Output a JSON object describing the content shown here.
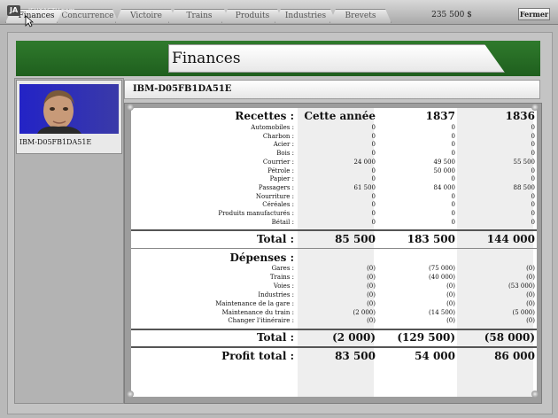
{
  "top_bar": {
    "logo": "JA",
    "logo_sub": "JEUXACTU.com",
    "tabs": [
      {
        "label": "Finances",
        "active": true
      },
      {
        "label": "Concurrence",
        "active": false
      },
      {
        "label": "Victoire",
        "active": false
      },
      {
        "label": "Trains",
        "active": false
      },
      {
        "label": "Produits",
        "active": false
      },
      {
        "label": "Industries",
        "active": false
      },
      {
        "label": "Brevets",
        "active": false
      }
    ],
    "money": "235 500 $",
    "close_label": "Fermer"
  },
  "page_title": "Finances",
  "company": {
    "name": "IBM-D05FB1DA51E"
  },
  "columns": [
    "Cette année",
    "1837",
    "1836"
  ],
  "revenue": {
    "heading": "Recettes :",
    "rows": [
      {
        "label": "Automobiles :",
        "values": [
          "0",
          "0",
          "0"
        ]
      },
      {
        "label": "Charbon :",
        "values": [
          "0",
          "0",
          "0"
        ]
      },
      {
        "label": "Acier :",
        "values": [
          "0",
          "0",
          "0"
        ]
      },
      {
        "label": "Bois :",
        "values": [
          "0",
          "0",
          "0"
        ]
      },
      {
        "label": "Courrier :",
        "values": [
          "24 000",
          "49 500",
          "55 500"
        ]
      },
      {
        "label": "Pétrole :",
        "values": [
          "0",
          "50 000",
          "0"
        ]
      },
      {
        "label": "Papier :",
        "values": [
          "0",
          "0",
          "0"
        ]
      },
      {
        "label": "Passagers :",
        "values": [
          "61 500",
          "84 000",
          "88 500"
        ]
      },
      {
        "label": "Nourriture :",
        "values": [
          "0",
          "0",
          "0"
        ]
      },
      {
        "label": "Céréales :",
        "values": [
          "0",
          "0",
          "0"
        ]
      },
      {
        "label": "Produits manufacturés :",
        "values": [
          "0",
          "0",
          "0"
        ]
      },
      {
        "label": "Bétail :",
        "values": [
          "0",
          "0",
          "0"
        ]
      }
    ],
    "total_label": "Total :",
    "totals": [
      "85 500",
      "183 500",
      "144 000"
    ]
  },
  "expenses": {
    "heading": "Dépenses :",
    "rows": [
      {
        "label": "Gares :",
        "values": [
          "(0)",
          "(75 000)",
          "(0)"
        ]
      },
      {
        "label": "Trains :",
        "values": [
          "(0)",
          "(40 000)",
          "(0)"
        ]
      },
      {
        "label": "Voies :",
        "values": [
          "(0)",
          "(0)",
          "(53 000)"
        ]
      },
      {
        "label": "Industries :",
        "values": [
          "(0)",
          "(0)",
          "(0)"
        ]
      },
      {
        "label": "Maintenance de la gare :",
        "values": [
          "(0)",
          "(0)",
          "(0)"
        ]
      },
      {
        "label": "Maintenance du train :",
        "values": [
          "(2 000)",
          "(14 500)",
          "(5 000)"
        ]
      },
      {
        "label": "Changer l'itinéraire :",
        "values": [
          "(0)",
          "(0)",
          "(0)"
        ]
      }
    ],
    "total_label": "Total :",
    "totals": [
      "(2 000)",
      "(129 500)",
      "(58 000)"
    ]
  },
  "profit": {
    "label": "Profit total :",
    "values": [
      "83 500",
      "54 000",
      "86 000"
    ]
  }
}
